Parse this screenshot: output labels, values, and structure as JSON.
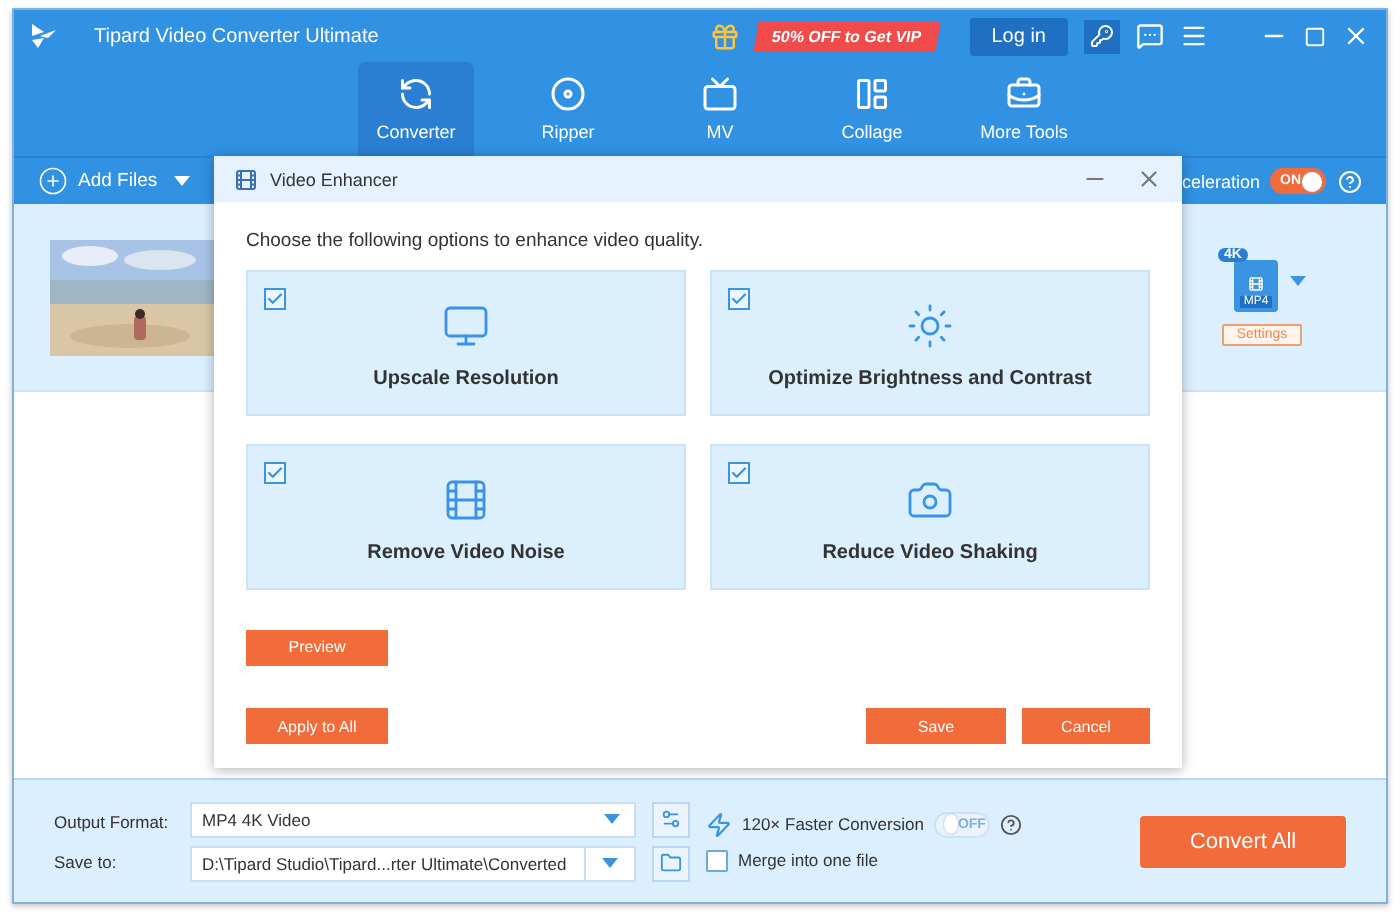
{
  "window": {
    "title": "Tipard Video Converter Ultimate",
    "promo": "50% OFF to Get VIP",
    "login": "Log in"
  },
  "tabs": [
    {
      "label": "Converter",
      "selected": true,
      "kind": "converter"
    },
    {
      "label": "Ripper",
      "selected": false,
      "kind": "ripper"
    },
    {
      "label": "MV",
      "selected": false,
      "kind": "mv"
    },
    {
      "label": "Collage",
      "selected": false,
      "kind": "collage"
    },
    {
      "label": "More Tools",
      "selected": false,
      "kind": "tools"
    }
  ],
  "toolbar": {
    "add_files": "Add Files",
    "acceleration_label": "celeration",
    "acceleration": {
      "on": true,
      "label": "ON"
    }
  },
  "file": {
    "badge": "4K",
    "format": "MP4",
    "settings": "Settings"
  },
  "dialog": {
    "title": "Video Enhancer",
    "instruction": "Choose the following options to enhance video quality.",
    "options": [
      {
        "label": "Upscale Resolution",
        "checked": true,
        "kind": "upscale"
      },
      {
        "label": "Optimize Brightness and Contrast",
        "checked": true,
        "kind": "brightness"
      },
      {
        "label": "Remove Video Noise",
        "checked": true,
        "kind": "denoise"
      },
      {
        "label": "Reduce Video Shaking",
        "checked": true,
        "kind": "stabilize"
      }
    ],
    "preview": "Preview",
    "apply_all": "Apply to All",
    "save": "Save",
    "cancel": "Cancel"
  },
  "bottom": {
    "output_format_label": "Output Format:",
    "output_format": "MP4 4K Video",
    "save_to_label": "Save to:",
    "save_to": "D:\\Tipard Studio\\Tipard...rter Ultimate\\Converted",
    "faster": "120× Faster Conversion",
    "faster_toggle": {
      "on": false,
      "label": "OFF"
    },
    "merge": "Merge into one file",
    "merge_checked": false,
    "convert_all": "Convert All"
  }
}
